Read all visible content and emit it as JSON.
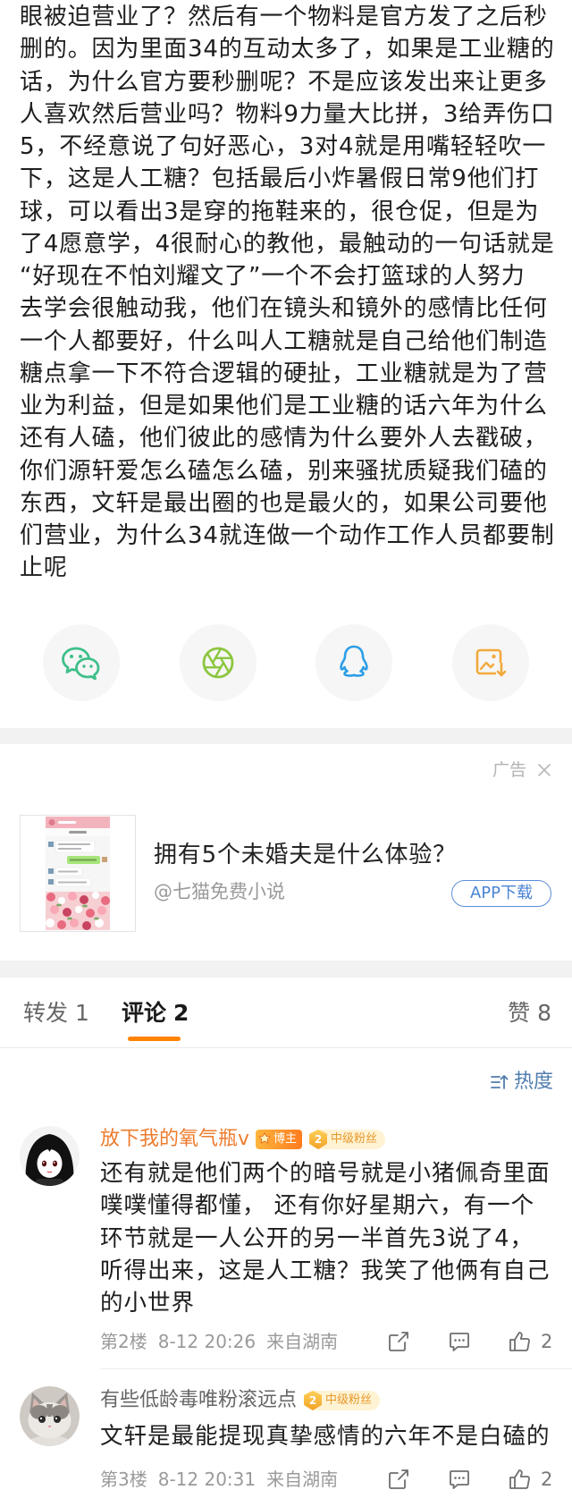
{
  "post": {
    "lines": [
      "眼被迫营业了？然后有一个物料是官方发了之后秒",
      "删的。因为里面34的互动太多了，如果是工业糖的",
      "话，为什么官方要秒删呢？不是应该发出来让更多",
      "人喜欢然后营业吗？物料9力量大比拼，3给弄伤口",
      "5，不经意说了句好恶心，3对4就是用嘴轻轻吹一",
      "下，这是人工糖？包括最后小炸暑假日常9他们打",
      "球，可以看出3是穿的拖鞋来的，很仓促，但是为",
      "了4愿意学，4很耐心的教他，最触动的一句话就是",
      "“好现在不怕刘耀文了”一个不会打篮球的人努力",
      "去学会很触动我，他们在镜头和镜外的感情比任何",
      "一个人都要好，什么叫人工糖就是自己给他们制造",
      "糖点拿一下不符合逻辑的硬扯，工业糖就是为了营",
      "业为利益，但是如果他们是工业糖的话六年为什么",
      "还有人磕，他们彼此的感情为什么要外人去戳破，",
      "你们源轩爱怎么磕怎么磕，别来骚扰质疑我们磕的",
      "东西，文轩是最出圈的也是最火的，如果公司要他",
      "们营业，为什么34就连做一个动作工作人员都要制",
      "止呢"
    ]
  },
  "share": {
    "items": [
      {
        "icon": "wechat-icon",
        "color": "#3fbf8a"
      },
      {
        "icon": "moments-icon",
        "color": "#8cc63e"
      },
      {
        "icon": "qq-icon",
        "color": "#2b9ee6"
      },
      {
        "icon": "save-image-icon",
        "color": "#f2a93b"
      }
    ]
  },
  "ad": {
    "label": "广告",
    "title": "拥有5个未婚夫是什么体验？",
    "source": "@七猫免费小说",
    "button": "APP下载"
  },
  "tabs": [
    {
      "label": "转发",
      "count": "1"
    },
    {
      "label": "评论",
      "count": "2",
      "active": true
    },
    {
      "label": "赞",
      "count": "8"
    }
  ],
  "sort": {
    "label": "热度"
  },
  "comments": [
    {
      "user": "放下我的氧气瓶v",
      "badges": {
        "blogger": "博主",
        "fan_level": "2",
        "fan": "中级粉丝"
      },
      "lines": [
        "还有就是他们两个的暗号就是小猪佩奇里面",
        "噗噗懂得都懂， 还有你好星期六，有一个",
        "环节就是一人公开的另一半首先3说了4，",
        "听得出来，这是人工糖？我笑了他俩有自己",
        "的小世界"
      ],
      "floor": "第2楼",
      "time": "8-12 20:26",
      "location": "来自湖南",
      "likes": "2"
    },
    {
      "user": "有些低龄毒唯粉滚远点",
      "badges": {
        "fan_level": "2",
        "fan": "中级粉丝"
      },
      "lines": [
        "文轩是最能提现真挚感情的六年不是白磕的"
      ],
      "floor": "第3楼",
      "time": "8-12 20:31",
      "location": "来自湖南",
      "likes": "2"
    }
  ],
  "colors": {
    "accent": "#ff8200",
    "link": "#507daf",
    "vip_name": "#ee7b2d",
    "band": "#f2f2f2"
  }
}
